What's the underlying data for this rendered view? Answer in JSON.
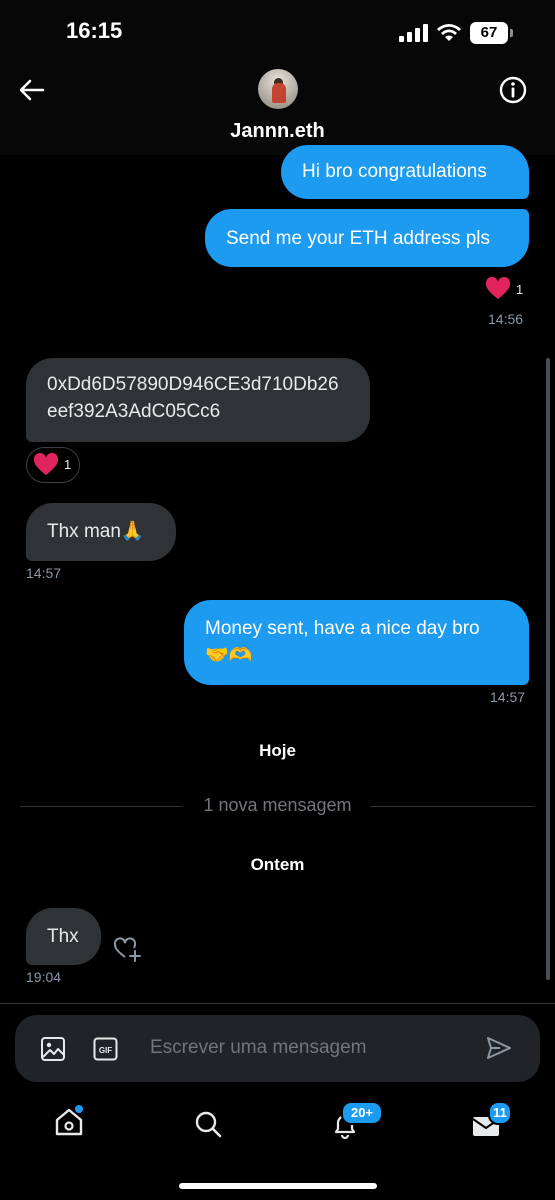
{
  "status_bar": {
    "time": "16:15",
    "battery": "67"
  },
  "header": {
    "contact_name": "Jannn.eth"
  },
  "messages": [
    {
      "text": "Hi bro congratulations"
    },
    {
      "text": "Send me your ETH address pls",
      "reaction_count": "1",
      "time": "14:56"
    },
    {
      "text": "0xDd6D57890D946CE3d710Db26eef392A3AdC05Cc6",
      "reaction_count": "1"
    },
    {
      "text": "Thx man🙏",
      "time": "14:57"
    },
    {
      "text": "Money sent, have a nice day bro 🤝🫶",
      "time": "14:57"
    },
    {
      "text": "Thx",
      "time": "19:04"
    }
  ],
  "separators": {
    "today": "Hoje",
    "new_message": "1 nova mensagem",
    "yesterday": "Ontem"
  },
  "composer": {
    "placeholder": "Escrever uma mensagem"
  },
  "nav": {
    "notifications_badge": "20+",
    "messages_badge": "11"
  },
  "colors": {
    "accent": "#1d9bf0",
    "incoming_bubble": "#2f3336",
    "heart": "#f91880"
  }
}
